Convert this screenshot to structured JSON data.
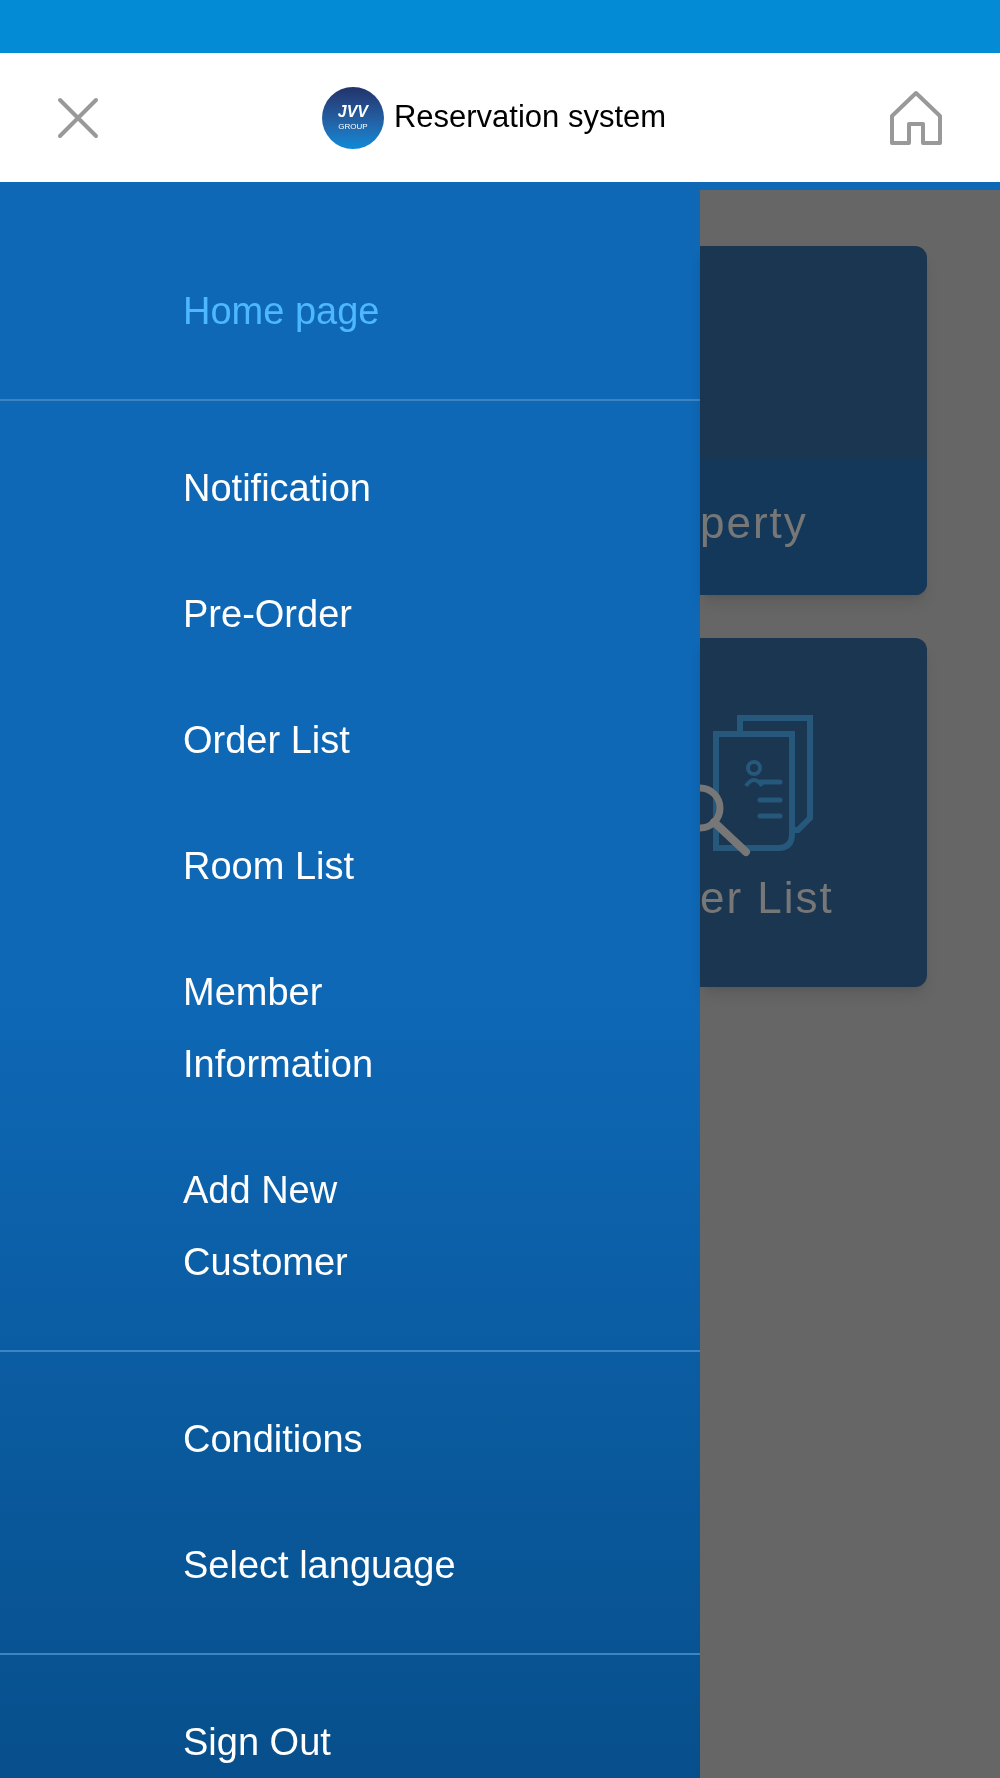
{
  "header": {
    "logo": {
      "mark": "JVV",
      "sub": "GROUP"
    },
    "title": "Reservation system"
  },
  "drawer": {
    "sections": [
      {
        "items": [
          {
            "label": "Home page",
            "selected": true
          }
        ]
      },
      {
        "items": [
          {
            "label": "Notification",
            "selected": false
          },
          {
            "label": "Pre-Order",
            "selected": false
          },
          {
            "label": "Order List",
            "selected": false
          },
          {
            "label": "Room List",
            "selected": false
          },
          {
            "label": "Member Information",
            "selected": false
          },
          {
            "label": "Add New Customer",
            "selected": false
          }
        ]
      },
      {
        "items": [
          {
            "label": "Conditions",
            "selected": false
          },
          {
            "label": "Select language",
            "selected": false
          }
        ]
      },
      {
        "items": [
          {
            "label": "Sign Out",
            "selected": false
          }
        ]
      }
    ]
  },
  "background_cards": [
    {
      "label": "perty",
      "kind": "plain"
    },
    {
      "label": "er List",
      "kind": "icon"
    }
  ]
}
